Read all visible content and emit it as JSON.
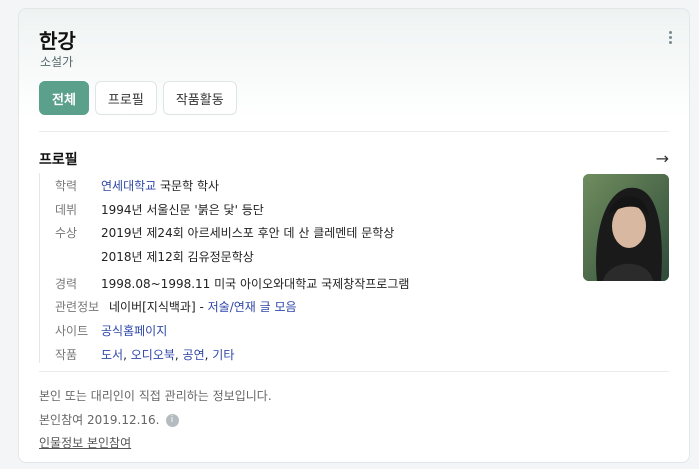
{
  "profile": {
    "name": "한강",
    "occupation": "소설가"
  },
  "tabs": [
    {
      "label": "전체",
      "active": true
    },
    {
      "label": "프로필",
      "active": false
    },
    {
      "label": "작품활동",
      "active": false
    }
  ],
  "section": {
    "title": "프로필"
  },
  "rows": {
    "education": {
      "label": "학력",
      "link": "연세대학교",
      "text": " 국문학 학사"
    },
    "debut": {
      "label": "데뷔",
      "text": "1994년 서울신문 '붉은 닻' 등단"
    },
    "awards": {
      "label": "수상",
      "line1": "2019년 제24회 아르세비스포 후안 데 산 클레멘테 문학상",
      "line2": "2018년 제12회 김유정문학상"
    },
    "career": {
      "label": "경력",
      "text": "1998.08~1998.11 미국 아이오와대학교 국제창작프로그램"
    },
    "related": {
      "label": "관련정보",
      "text": "네이버[지식백과] - ",
      "link": "저술/연재 글 모음"
    },
    "site": {
      "label": "사이트",
      "link": "공식홈페이지"
    },
    "works": {
      "label": "작품",
      "links": [
        "도서",
        "오디오북",
        "공연",
        "기타"
      ],
      "separator": ", "
    }
  },
  "footer": {
    "notice": "본인 또는 대리인이 직접 관리하는 정보입니다.",
    "participation": "본인참여 2019.12.16.",
    "participation_link": "인물정보 본인참여"
  },
  "icons": {
    "more": "more-vertical-icon",
    "arrow": "arrow-right-icon",
    "info": "info-icon"
  },
  "colors": {
    "accent": "#5aa08b",
    "link": "#2f47a8"
  }
}
